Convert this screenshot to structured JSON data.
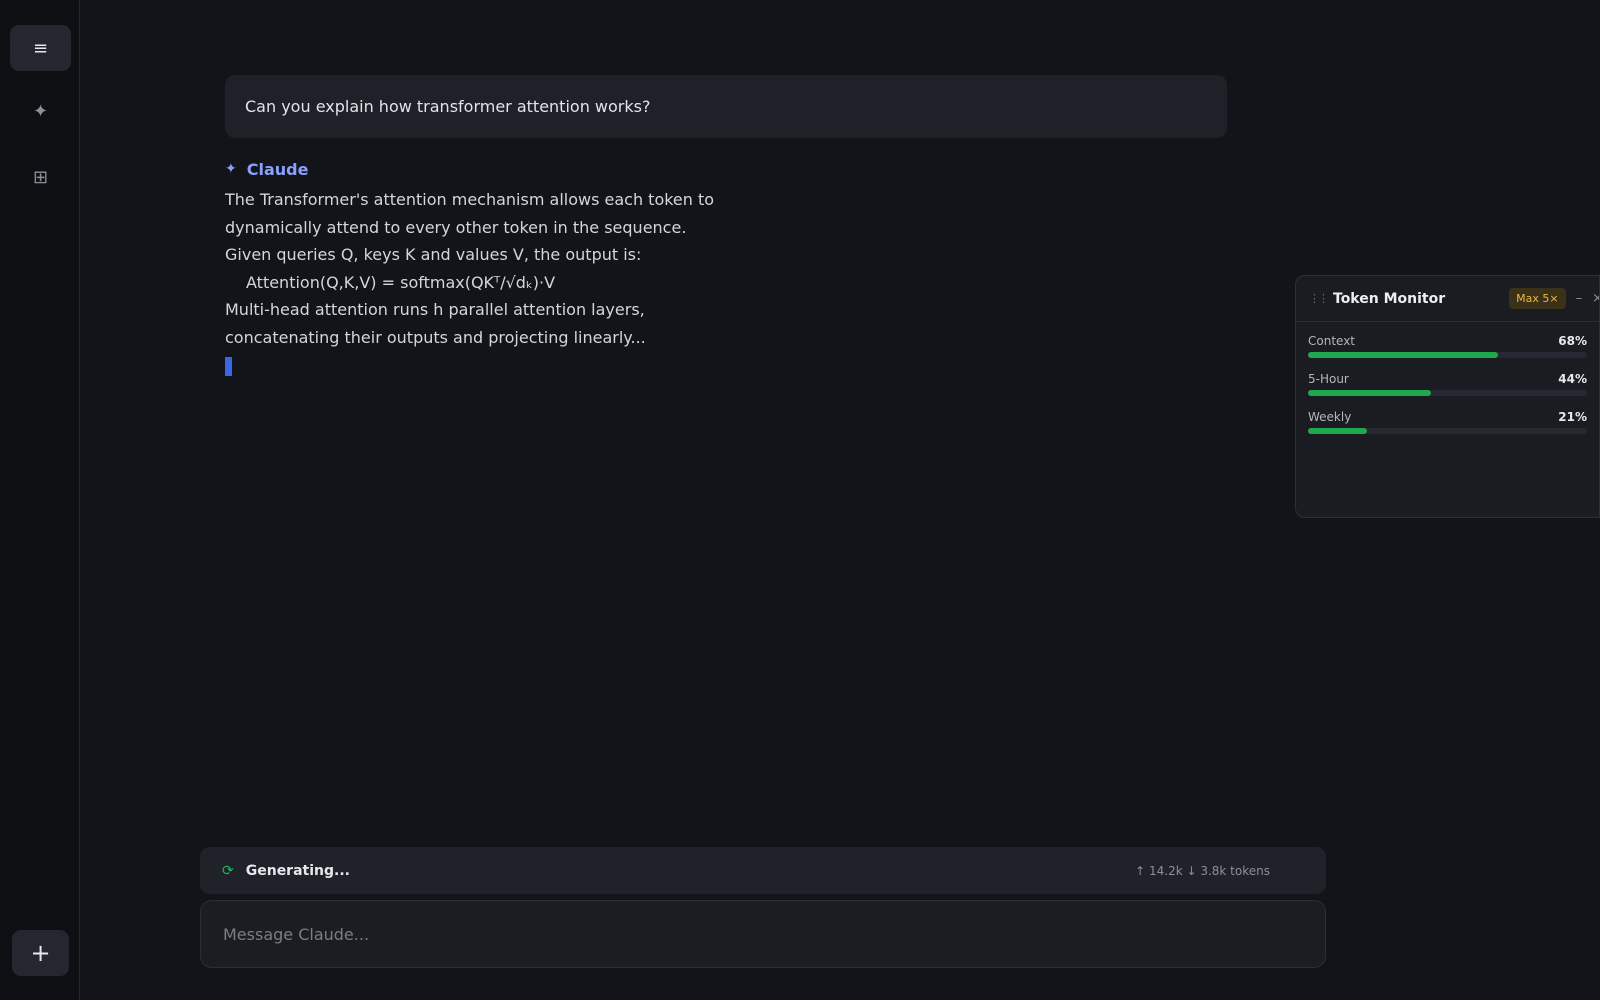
{
  "sidebar": {
    "menu_icon": "hamburger-icon",
    "items": [
      {
        "icon": "sparkle-icon"
      },
      {
        "icon": "grid-icon"
      }
    ],
    "new_chat_icon": "plus-icon"
  },
  "conversation": {
    "user_message": "Can you explain how transformer attention works?",
    "assistant": {
      "name": "Claude",
      "lines": [
        "The Transformer's attention mechanism allows each token to",
        "dynamically attend to every other token in the sequence.",
        "Given queries Q, keys K and values V, the output is:",
        "Attention(Q,K,V) = softmax(QKᵀ/√dₖ)·V",
        "Multi-head attention runs h parallel attention layers,",
        "concatenating their outputs and projecting linearly..."
      ]
    }
  },
  "status": {
    "text": "Generating...",
    "tokens": "↑ 14.2k  ↓ 3.8k tokens"
  },
  "composer": {
    "placeholder": "Message Claude..."
  },
  "token_monitor": {
    "title": "Token Monitor",
    "plan_badge": "Max 5×",
    "minimize_glyph": "–",
    "close_glyph": "×",
    "meters": [
      {
        "label": "Context",
        "percent": 68,
        "display": "68%"
      },
      {
        "label": "5-Hour",
        "percent": 44,
        "display": "44%"
      },
      {
        "label": "Weekly",
        "percent": 21,
        "display": "21%"
      }
    ]
  },
  "colors": {
    "accent": "#8aa0ff",
    "meter_fill": "#1fa84e",
    "badge_text": "#f0b83a",
    "cursor": "#3a66e8"
  }
}
